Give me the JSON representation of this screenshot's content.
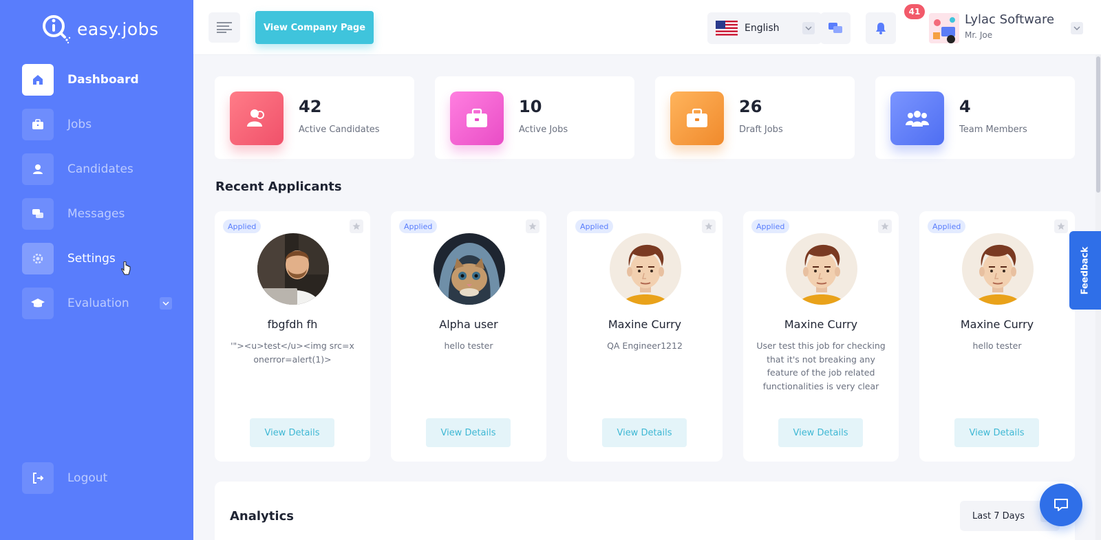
{
  "brand": {
    "name": "easy.jobs"
  },
  "sidebar": {
    "items": [
      {
        "label": "Dashboard",
        "icon": "home-icon"
      },
      {
        "label": "Jobs",
        "icon": "briefcase-icon"
      },
      {
        "label": "Candidates",
        "icon": "user-icon"
      },
      {
        "label": "Messages",
        "icon": "chat-icon"
      },
      {
        "label": "Settings",
        "icon": "gear-icon"
      },
      {
        "label": "Evaluation",
        "icon": "graduation-cap-icon"
      }
    ],
    "logout": "Logout"
  },
  "topbar": {
    "company_page_button": "View Company Page",
    "language": "English",
    "notification_count": "41",
    "company_name": "Lylac Software",
    "user_name": "Mr. Joe"
  },
  "stats": [
    {
      "value": "42",
      "label": "Active Candidates",
      "color": "#f36a7a"
    },
    {
      "value": "10",
      "label": "Active Jobs",
      "color": "#f567cf"
    },
    {
      "value": "26",
      "label": "Draft Jobs",
      "color": "#f5a142"
    },
    {
      "value": "4",
      "label": "Team Members",
      "color": "#5b7cf6"
    }
  ],
  "recent_applicants": {
    "title": "Recent Applicants",
    "status_label": "Applied",
    "button_label": "View Details",
    "items": [
      {
        "name": "fbgfdh fh",
        "subtitle": "'\"><u>test</u><img src=x onerror=alert(1)>"
      },
      {
        "name": "Alpha user",
        "subtitle": "hello tester"
      },
      {
        "name": "Maxine Curry",
        "subtitle": "QA Engineer1212"
      },
      {
        "name": "Maxine Curry",
        "subtitle": "User test this job for checking that it's not breaking any feature of the job related functionalities is very clear"
      },
      {
        "name": "Maxine Curry",
        "subtitle": "hello tester"
      }
    ]
  },
  "analytics": {
    "title": "Analytics",
    "range": "Last 7 Days"
  },
  "feedback_label": "Feedback",
  "colors": {
    "sidebar": "#597dfc",
    "accent": "#3fc4dc",
    "badge": "#f25a6a"
  }
}
